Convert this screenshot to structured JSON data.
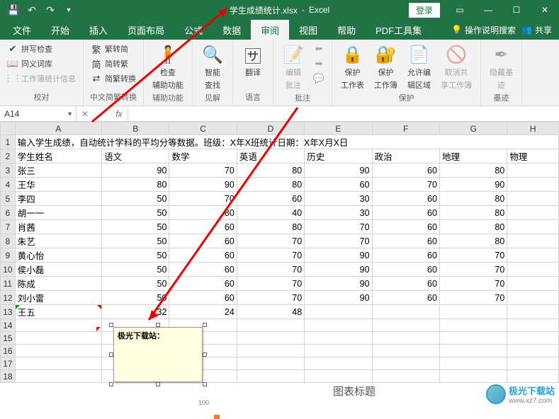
{
  "title": {
    "filename": "学生成绩统计.xlsx",
    "app": "Excel",
    "login": "登录"
  },
  "tabs": {
    "file": "文件",
    "home": "开始",
    "insert": "插入",
    "layout": "页面布局",
    "formula": "公式",
    "data": "数据",
    "review": "审阅",
    "view": "视图",
    "help": "帮助",
    "pdf": "PDF工具集"
  },
  "ribbon_right": {
    "help": "操作说明搜索",
    "share": "共享"
  },
  "ribbon": {
    "g1": {
      "label": "校对",
      "spell": "拼写检查",
      "thes": "同义词库",
      "stats": "工作簿统计信息"
    },
    "g2": {
      "label": "中文简繁转换",
      "ts": "繁转简",
      "st": "简转繁",
      "conv": "简繁转换"
    },
    "g3": {
      "label": "辅助功能",
      "check": "检查",
      "sub": "辅助功能"
    },
    "g4": {
      "label": "见解",
      "smart": "智能",
      "lookup": "查找"
    },
    "g5": {
      "label": "语言",
      "translate": "翻译"
    },
    "g6": {
      "label": "批注",
      "edit": "编辑",
      "sub": "批注"
    },
    "g7": {
      "label": "保护",
      "ps": "保护",
      "psheet": "工作表",
      "pb": "保护",
      "pbook": "工作簿",
      "allow": "允许编",
      "allow2": "辑区域",
      "unshare": "取消共",
      "unshare2": "享工作簿"
    },
    "g8": {
      "label": "墨迹",
      "ink": "隐藏墨",
      "ink2": "迹"
    }
  },
  "namebox": "A14",
  "headers": [
    "A",
    "B",
    "C",
    "D",
    "E",
    "F",
    "G",
    "H"
  ],
  "row1": "输入学生成绩，自动统计学科的平均分等数据。班级：X年X班统计日期：X年X月X日",
  "row2": {
    "a": "学生姓名",
    "b": "语文",
    "c": "数学",
    "d": "英语",
    "e": "历史",
    "f": "政治",
    "g": "地理",
    "h": "物理"
  },
  "data_rows": [
    {
      "n": "张三",
      "v": [
        90,
        70,
        80,
        90,
        60,
        80
      ]
    },
    {
      "n": "王华",
      "v": [
        80,
        90,
        80,
        60,
        70,
        90
      ]
    },
    {
      "n": "李四",
      "v": [
        50,
        70,
        60,
        30,
        60,
        80
      ]
    },
    {
      "n": "胡一一",
      "v": [
        50,
        80,
        40,
        30,
        60,
        80
      ]
    },
    {
      "n": "肖茜",
      "v": [
        50,
        60,
        80,
        70,
        60,
        80
      ]
    },
    {
      "n": "朱艺",
      "v": [
        50,
        60,
        70,
        70,
        60,
        80
      ]
    },
    {
      "n": "黄心怡",
      "v": [
        50,
        60,
        70,
        90,
        60,
        70
      ]
    },
    {
      "n": "侯小磊",
      "v": [
        50,
        60,
        70,
        90,
        60,
        70
      ]
    },
    {
      "n": "陈成",
      "v": [
        50,
        60,
        70,
        90,
        60,
        70
      ]
    },
    {
      "n": "刘小雷",
      "v": [
        50,
        60,
        70,
        90,
        60,
        70
      ]
    },
    {
      "n": "王五",
      "v": [
        32,
        24,
        48,
        "",
        "",
        ""
      ]
    }
  ],
  "comment": {
    "author": "极光下载站："
  },
  "chart": {
    "title": "图表标题",
    "tick": "100"
  },
  "watermark": {
    "brand": "极光下载站",
    "url": "www.xz7.com"
  },
  "chart_data": {
    "type": "bar",
    "title": "图表标题",
    "partial": true,
    "ylim": [
      0,
      100
    ],
    "visible_ticks": [
      100
    ]
  }
}
